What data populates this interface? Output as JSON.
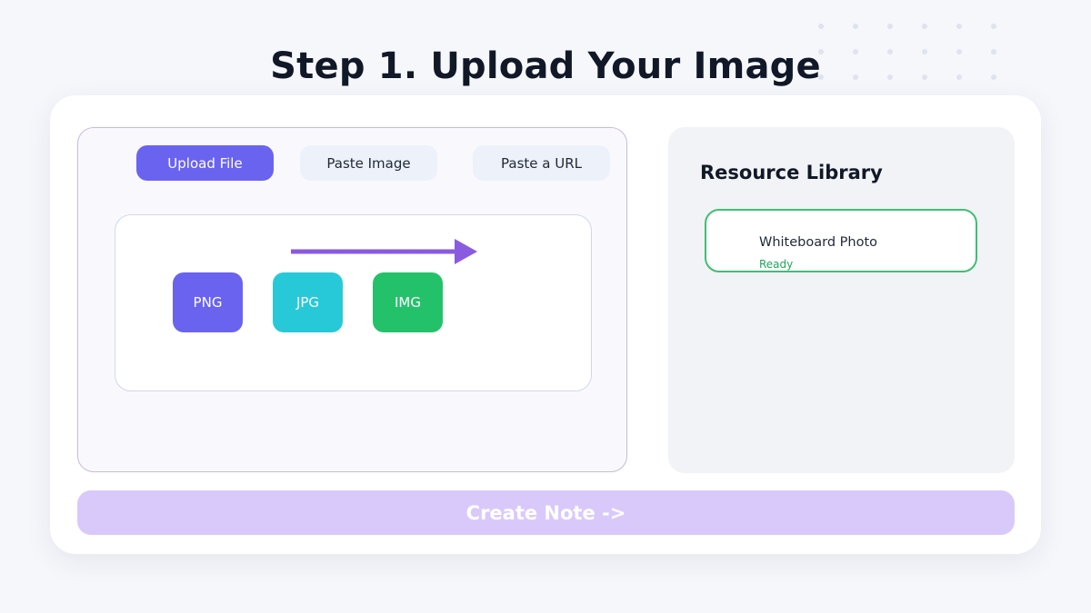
{
  "page": {
    "title": "Step 1. Upload Your Image"
  },
  "upload": {
    "tabs": [
      {
        "label": "Upload File",
        "active": true
      },
      {
        "label": "Paste Image",
        "active": false
      },
      {
        "label": "Paste a URL",
        "active": false
      }
    ],
    "file_types": [
      "PNG",
      "JPG",
      "IMG"
    ],
    "arrow_icon": "arrow-right-icon"
  },
  "library": {
    "title": "Resource Library",
    "items": [
      {
        "name": "Whiteboard Photo",
        "status": "Ready"
      }
    ]
  },
  "action": {
    "create_label": "Create Note  ->"
  },
  "colors": {
    "primary": "#6a63f0",
    "cyan": "#27c9d8",
    "green": "#23c26a",
    "ready": "#22a55a",
    "arrow": "#8a5be0",
    "create_button_bg": "#d9c9fb"
  }
}
